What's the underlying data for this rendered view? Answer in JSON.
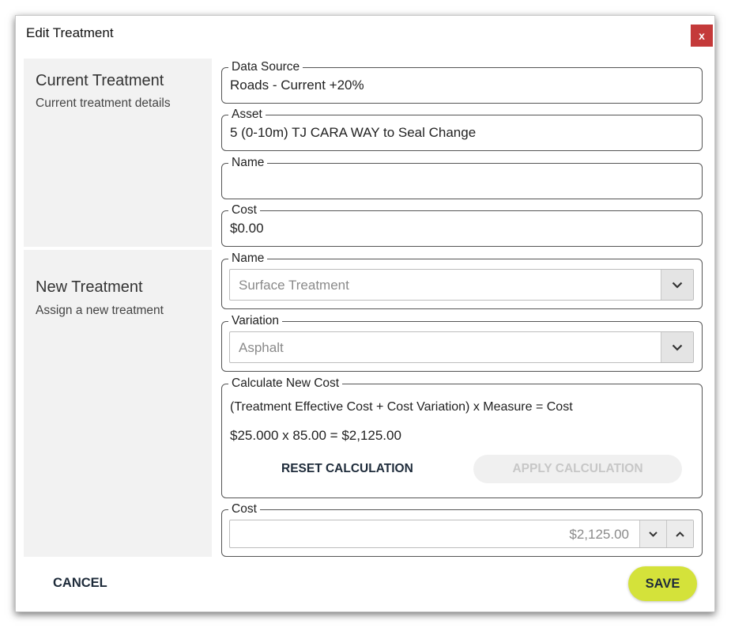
{
  "dialog": {
    "title": "Edit Treatment",
    "close_label": "x"
  },
  "current_section": {
    "title": "Current Treatment",
    "subtitle": "Current treatment details"
  },
  "new_section": {
    "title": "New Treatment",
    "subtitle": "Assign a new treatment"
  },
  "fields": {
    "data_source": {
      "label": "Data Source",
      "value": "Roads - Current +20%"
    },
    "asset": {
      "label": "Asset",
      "value": "5 (0-10m) TJ CARA WAY to Seal Change"
    },
    "current_name": {
      "label": "Name",
      "value": ""
    },
    "current_cost": {
      "label": "Cost",
      "value": "$0.00"
    },
    "new_name": {
      "label": "Name",
      "value": "Surface Treatment",
      "icon": "chevron-down-icon"
    },
    "variation": {
      "label": "Variation",
      "value": "Asphalt",
      "icon": "chevron-down-icon"
    },
    "new_cost": {
      "label": "Cost",
      "value": "$2,125.00"
    }
  },
  "calculation": {
    "label": "Calculate New Cost",
    "formula": "(Treatment Effective Cost + Cost Variation) x Measure = Cost",
    "result": "$25.000 x 85.00 = $2,125.00",
    "reset_label": "RESET CALCULATION",
    "apply_label": "APPLY CALCULATION"
  },
  "footer": {
    "cancel_label": "CANCEL",
    "save_label": "SAVE"
  },
  "colors": {
    "close_bg": "#c43a3a",
    "save_bg": "#d4e23a",
    "section_bg": "#f2f2f2",
    "button_text": "#1e2b3a"
  }
}
